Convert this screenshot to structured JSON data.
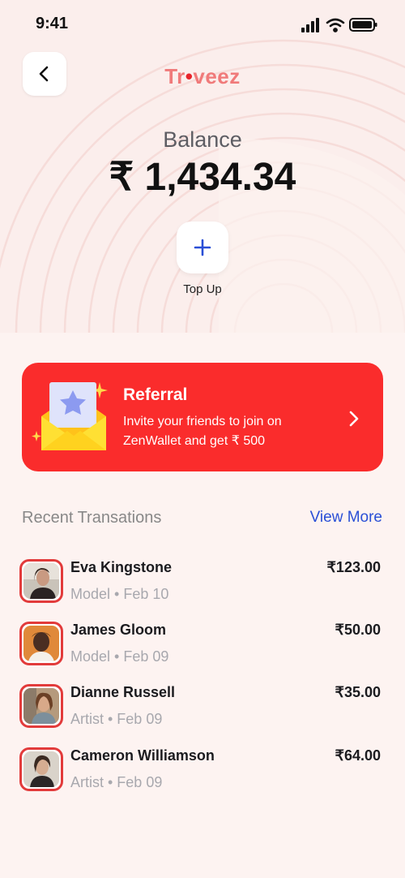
{
  "status_bar": {
    "time": "9:41"
  },
  "header": {
    "logo_main": "Troveez"
  },
  "balance": {
    "label": "Balance",
    "amount": "₹ 1,434.34"
  },
  "topup": {
    "label": "Top Up"
  },
  "referral": {
    "title": "Referral",
    "description": "Invite your friends to join on ZenWallet and get ₹ 500"
  },
  "transactions": {
    "title": "Recent Transations",
    "view_more": "View More",
    "items": [
      {
        "name": "Eva Kingstone",
        "meta": "Model • Feb 10",
        "amount": "₹123.00"
      },
      {
        "name": "James Gloom",
        "meta": "Model • Feb 09",
        "amount": "₹50.00"
      },
      {
        "name": "Dianne Russell",
        "meta": "Artist • Feb 09",
        "amount": "₹35.00"
      },
      {
        "name": "Cameron Williamson",
        "meta": "Artist • Feb 09",
        "amount": "₹64.00"
      }
    ]
  },
  "colors": {
    "background": "#fdf3f1",
    "accent_red": "#fa2c2c",
    "link_blue": "#2a4fd6",
    "logo_pink": "#f07a7a"
  },
  "icons": {
    "back": "chevron-left-icon",
    "topup": "plus-icon",
    "referral": "envelope-star-icon",
    "referral_go": "chevron-right-icon"
  }
}
